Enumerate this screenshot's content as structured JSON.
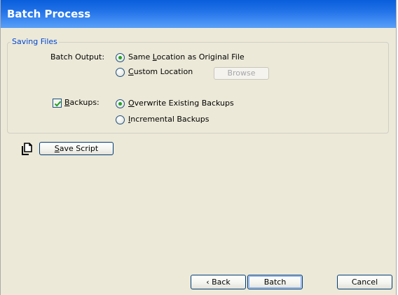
{
  "window": {
    "title": "Batch Process"
  },
  "saving_files": {
    "legend": "Saving Files",
    "batch_output": {
      "label": "Batch Output:",
      "same_location": {
        "pre": "Same ",
        "key": "L",
        "post": "ocation as Original File",
        "checked": true
      },
      "custom_location": {
        "pre": "",
        "key": "C",
        "post": "ustom Location",
        "checked": false
      },
      "browse_label": "Browse"
    },
    "backups": {
      "pre": "",
      "key": "B",
      "post": "ackups:",
      "checked": true,
      "overwrite": {
        "pre": "",
        "key": "O",
        "post": "verwrite Existing Backups",
        "checked": true
      },
      "incremental": {
        "pre": "",
        "key": "I",
        "post": "ncremental Backups",
        "checked": false
      }
    }
  },
  "save_script": {
    "pre": "",
    "key": "S",
    "post": "ave Script",
    "icon": "script-document-icon"
  },
  "footer": {
    "back_label": "‹ Back",
    "batch_label": "Batch",
    "cancel_label": "Cancel"
  },
  "colors": {
    "title_bar": "#0a5edb",
    "dialog_bg": "#ece9d8",
    "legend_text": "#0046d5",
    "radio_dot": "#21a121",
    "check_mark": "#21a121"
  }
}
